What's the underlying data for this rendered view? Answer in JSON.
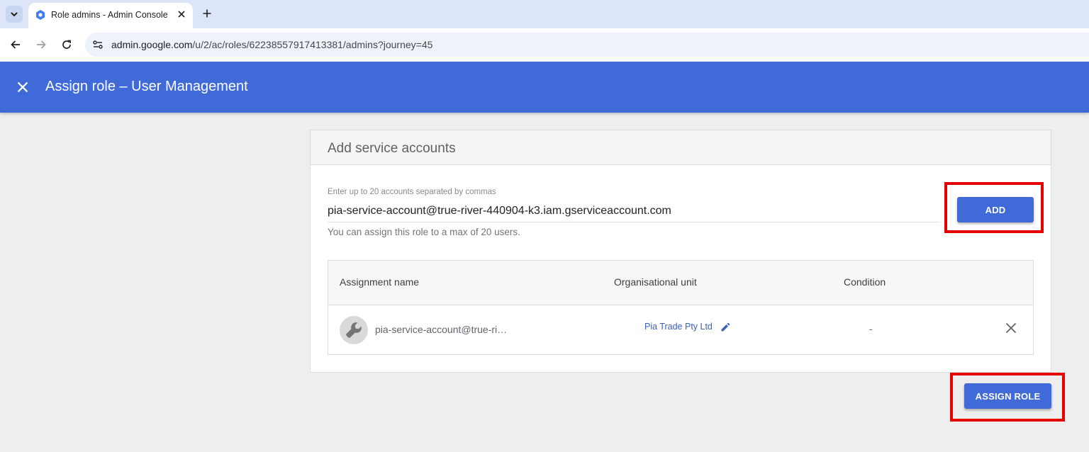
{
  "browser": {
    "tab": {
      "title": "Role admins - Admin Console",
      "favicon": "admin-console-hex-icon"
    },
    "url": {
      "domain": "admin.google.com",
      "path": "/u/2/ac/roles/62238557917413381/admins?journey=45"
    }
  },
  "header": {
    "title": "Assign role – User Management",
    "close_icon": "close-icon",
    "color": "#3f6ad8"
  },
  "card": {
    "heading": "Add service accounts",
    "field_label": "Enter up to 20 accounts separated by commas",
    "field_value": "pia-service-account@true-river-440904-k3.iam.gserviceaccount.com",
    "helper_text": "You can assign this role to a max of 20 users.",
    "add_label": "ADD"
  },
  "table": {
    "columns": [
      "Assignment name",
      "Organisational unit",
      "Condition"
    ],
    "rows": [
      {
        "name": "pia-service-account@true-ri…",
        "org_unit": "Pia Trade Pty Ltd",
        "condition": "-",
        "avatar_icon": "wrench-icon"
      }
    ]
  },
  "actions": {
    "assign_label": "ASSIGN ROLE"
  },
  "colors": {
    "accent": "#3f6ad8",
    "highlight": "#e60000",
    "link": "#3f5fb8"
  }
}
